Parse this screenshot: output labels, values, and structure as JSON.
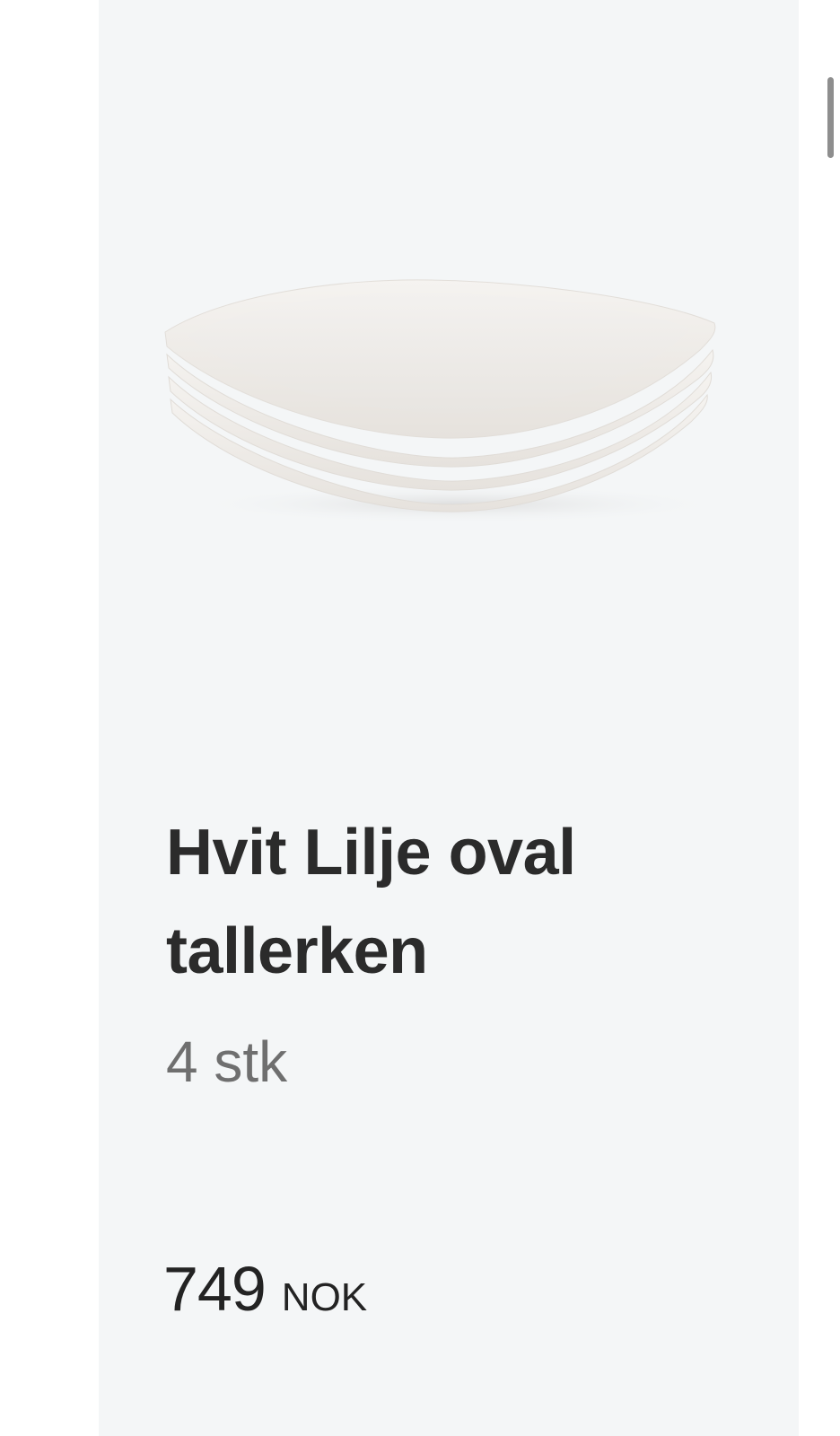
{
  "product": {
    "image_description_icon": "stacked-oval-plates-image",
    "title": "Hvit Lilje oval tallerken",
    "quantity": "4 stk",
    "price_amount": "749",
    "price_currency": "NOK"
  },
  "colors": {
    "card_background": "#f4f6f7",
    "title": "#2b2b2b",
    "quantity": "#6f6f6f",
    "price": "#232323"
  }
}
